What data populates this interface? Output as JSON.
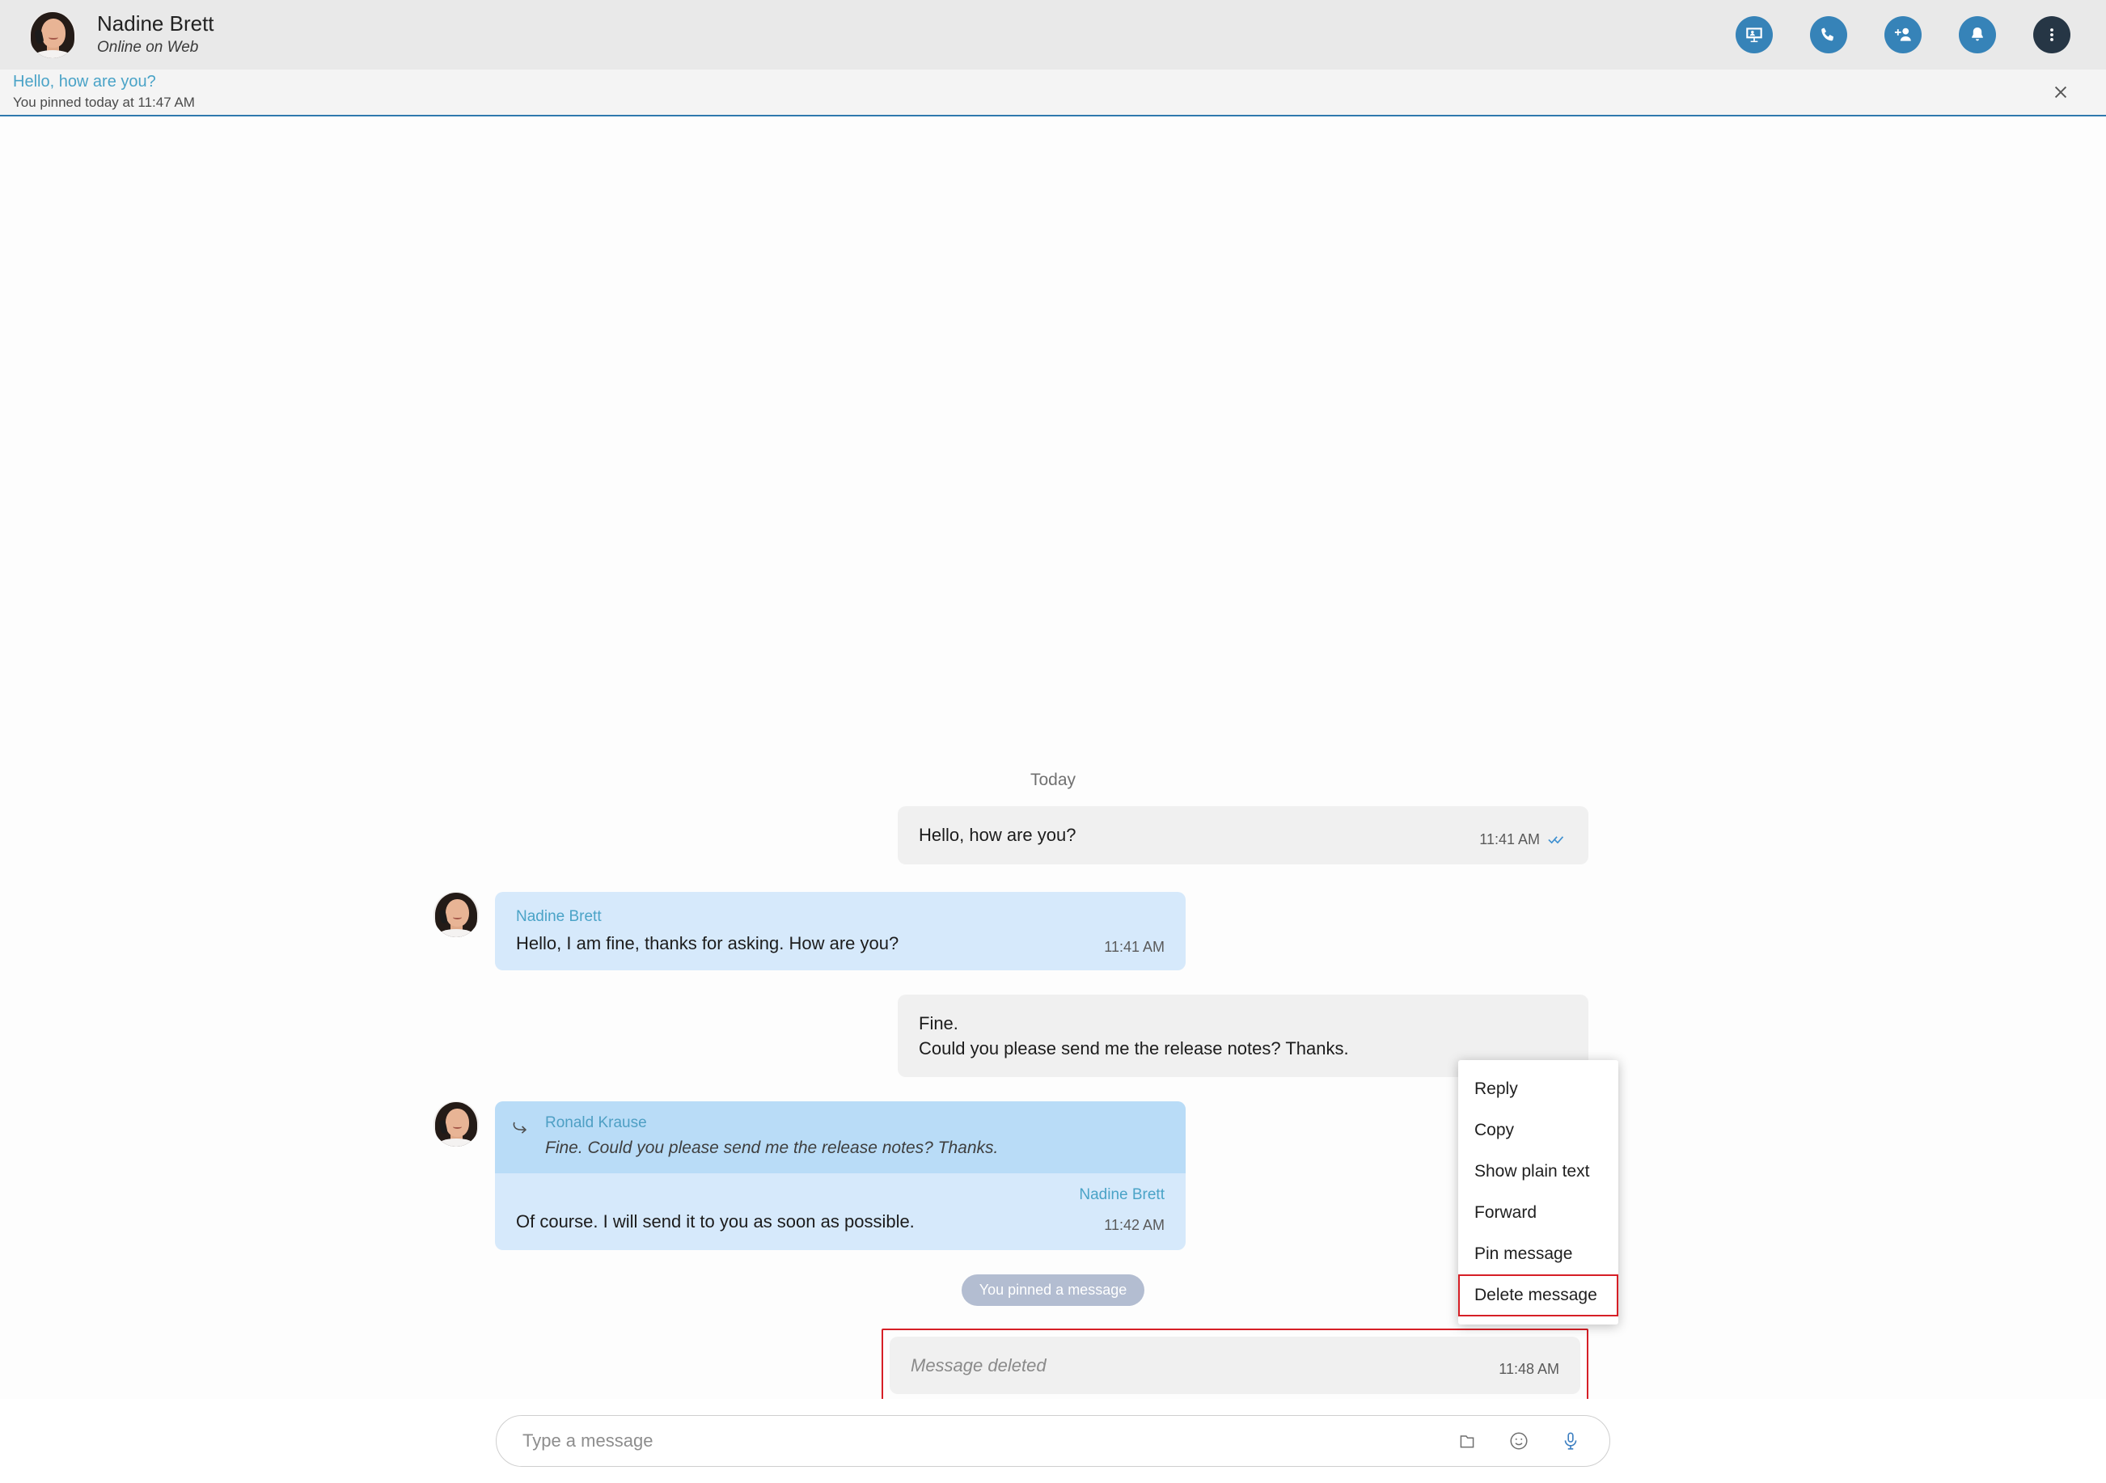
{
  "header": {
    "contact_name": "Nadine Brett",
    "status": "Online on Web",
    "avatar_alt": "contact-avatar",
    "actions": [
      {
        "name": "screen-share-icon",
        "label": "Screen share"
      },
      {
        "name": "phone-call-icon",
        "label": "Call"
      },
      {
        "name": "add-person-icon",
        "label": "Add participant"
      },
      {
        "name": "bell-icon",
        "label": "Notifications"
      },
      {
        "name": "more-options-icon",
        "label": "More options"
      }
    ]
  },
  "pinned": {
    "title": "Hello, how are you?",
    "subtitle": "You pinned today at 11:47 AM",
    "close_label": "×"
  },
  "conversation": {
    "day_separator": "Today",
    "messages": [
      {
        "id": "m1",
        "direction": "out",
        "text": "Hello, how are you?",
        "time": "11:41 AM",
        "read_status": "read"
      },
      {
        "id": "m2",
        "direction": "in",
        "sender": "Nadine Brett",
        "text": "Hello, I am fine, thanks for asking. How are you?",
        "time": "11:41 AM"
      },
      {
        "id": "m3",
        "direction": "out",
        "text": "Fine.\nCould you please send me the release notes? Thanks.",
        "time": ""
      },
      {
        "id": "m4",
        "direction": "in",
        "sender": "Nadine Brett",
        "quote_sender": "Ronald Krause",
        "quote_text": "Fine. Could you please send me the release notes? Thanks.",
        "text": "Of course. I will send it to you as soon as possible.",
        "time": "11:42 AM"
      },
      {
        "id": "m5",
        "direction": "system",
        "text": "You pinned a message"
      },
      {
        "id": "m6",
        "direction": "out",
        "text": "Message deleted",
        "time": "11:48 AM",
        "deleted": true,
        "highlighted": true
      }
    ]
  },
  "context_menu": {
    "items": [
      {
        "label": "Reply",
        "highlighted": false
      },
      {
        "label": "Copy",
        "highlighted": false
      },
      {
        "label": "Show plain text",
        "highlighted": false
      },
      {
        "label": "Forward",
        "highlighted": false
      },
      {
        "label": "Pin message",
        "highlighted": false
      },
      {
        "label": "Delete message",
        "highlighted": true
      }
    ]
  },
  "composer": {
    "placeholder": "Type a message",
    "value": "",
    "icons": [
      {
        "name": "attach-file-icon"
      },
      {
        "name": "emoji-icon"
      },
      {
        "name": "microphone-icon"
      }
    ]
  },
  "colors": {
    "accent_blue": "#3683b8",
    "link_blue": "#4aa3c7",
    "incoming_bubble": "#d6e9fb",
    "quote_bubble": "#b9dcf7",
    "outgoing_bubble": "#f0f0f0",
    "header_bg": "#e9e9e9",
    "pinned_bg": "#f4f4f4",
    "highlight_red": "#d61f26",
    "system_pill": "#b3bdd1"
  }
}
